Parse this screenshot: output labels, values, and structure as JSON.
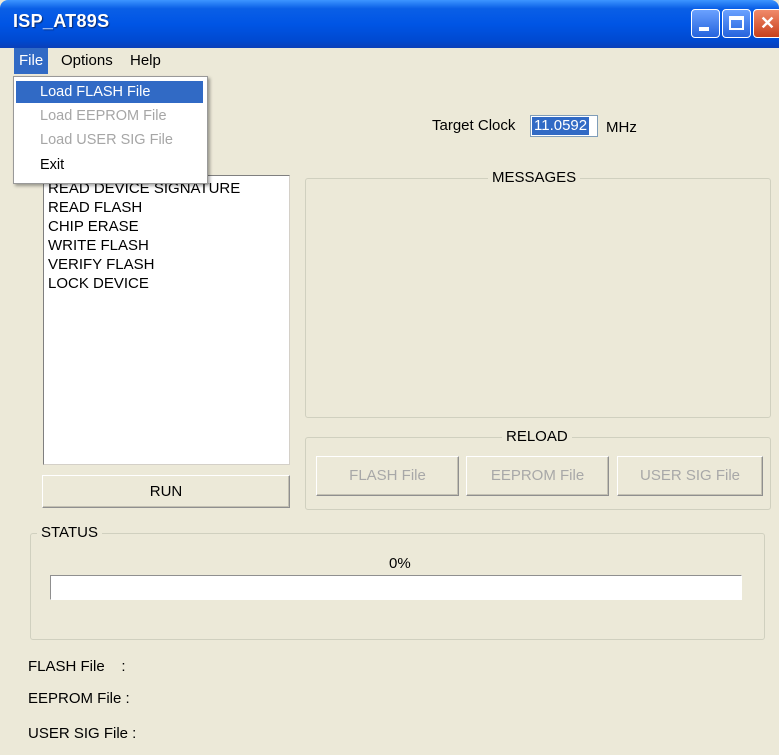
{
  "window": {
    "title": "ISP_AT89S"
  },
  "menubar": {
    "file": "File",
    "options": "Options",
    "help": "Help"
  },
  "file_menu": {
    "items": [
      {
        "label": "Load FLASH File",
        "state": "highlighted"
      },
      {
        "label": "Load EEPROM File",
        "state": "disabled"
      },
      {
        "label": "Load USER SIG File",
        "state": "disabled"
      },
      {
        "label": "Exit",
        "state": "enabled"
      }
    ]
  },
  "clock": {
    "label": "Target Clock",
    "value": "11.0592",
    "unit": "MHz"
  },
  "commands": [
    "READ DEVICE SIGNATURE",
    "READ FLASH",
    "CHIP ERASE",
    "WRITE FLASH",
    "VERIFY FLASH",
    "LOCK DEVICE"
  ],
  "run_label": "RUN",
  "messages": {
    "title": "MESSAGES"
  },
  "reload": {
    "title": "RELOAD",
    "flash": "FLASH File",
    "eeprom": "EEPROM File",
    "usersig": "USER SIG  File"
  },
  "status": {
    "title": "STATUS",
    "percent_text": "0%",
    "progress": 0
  },
  "files": {
    "flash": "FLASH File    :",
    "eeprom": "EEPROM File :",
    "usersig": "USER SIG File :"
  },
  "colors": {
    "selection": "#316ac5",
    "face": "#ece9d8",
    "titlebar": "#0055e5"
  }
}
